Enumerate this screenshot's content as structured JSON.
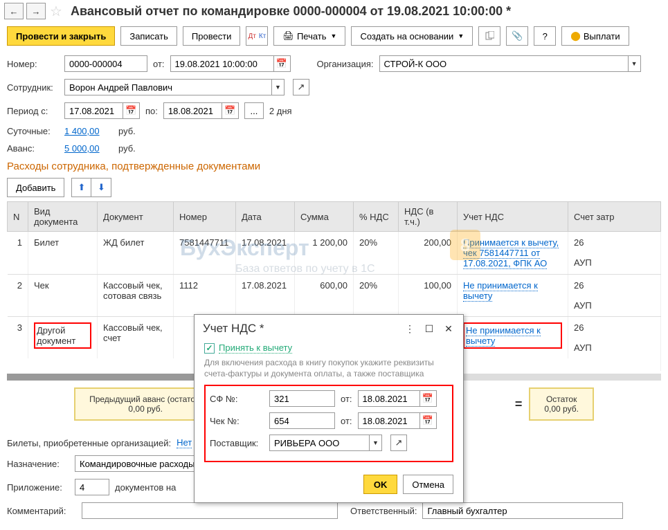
{
  "header": {
    "title": "Авансовый отчет по командировке 0000-000004 от 19.08.2021 10:00:00 *"
  },
  "toolbar": {
    "post_close": "Провести и закрыть",
    "write": "Записать",
    "post": "Провести",
    "print": "Печать",
    "create_based": "Создать на основании",
    "pay": "Выплати"
  },
  "form": {
    "number_label": "Номер:",
    "number": "0000-000004",
    "from_label": "от:",
    "date": "19.08.2021 10:00:00",
    "org_label": "Организация:",
    "org": "СТРОЙ-К ООО",
    "employee_label": "Сотрудник:",
    "employee": "Ворон Андрей Павлович",
    "period_from_label": "Период с:",
    "period_from": "17.08.2021",
    "period_to_label": "по:",
    "period_to": "18.08.2021",
    "days": "2 дня",
    "perdiem_label": "Суточные:",
    "perdiem": "1 400,00",
    "advance_label": "Аванс:",
    "advance": "5 000,00",
    "rub": "руб."
  },
  "section": {
    "title": "Расходы сотрудника, подтвержденные документами",
    "add": "Добавить"
  },
  "table": {
    "headers": {
      "n": "N",
      "doc_type": "Вид документа",
      "doc": "Документ",
      "num": "Номер",
      "date": "Дата",
      "sum": "Сумма",
      "vat_pct": "% НДС",
      "vat_incl": "НДС (в т.ч.)",
      "vat_acc": "Учет НДС",
      "exp_acc": "Счет затр"
    },
    "rows": [
      {
        "n": "1",
        "doc_type": "Билет",
        "doc": "ЖД билет",
        "num": "7581447711",
        "date": "17.08.2021",
        "sum": "1 200,00",
        "vat_pct": "20%",
        "vat_incl": "200,00",
        "vat_acc": "Принимается к вычету, чек 7581447711 от 17.08.2021, ФПК АО",
        "exp1": "26",
        "exp2": "АУП"
      },
      {
        "n": "2",
        "doc_type": "Чек",
        "doc": "Кассовый чек, сотовая связь",
        "num": "1112",
        "date": "17.08.2021",
        "sum": "600,00",
        "vat_pct": "20%",
        "vat_incl": "100,00",
        "vat_acc": "Не принимается к вычету",
        "exp1": "26",
        "exp2": "АУП"
      },
      {
        "n": "3",
        "doc_type": "Другой документ",
        "doc": "Кассовый чек, счет",
        "num": "",
        "date": "",
        "sum": "",
        "vat_pct": "",
        "vat_incl": "",
        "vat_acc": "Не принимается к вычету",
        "exp1": "26",
        "exp2": "АУП"
      }
    ]
  },
  "summary": {
    "prev": "Предыдущий аванс (остаток)",
    "prev_val": "0,00 руб.",
    "rest": "Остаток",
    "rest_val": "0,00 руб."
  },
  "bottom": {
    "tickets_label": "Билеты, приобретенные организацией:",
    "tickets_link": "Нет",
    "purpose_label": "Назначение:",
    "purpose": "Командировочные расходы",
    "attach_label": "Приложение:",
    "attach_val": "4",
    "attach_suffix": "документов на",
    "comment_label": "Комментарий:",
    "responsible_label": "Ответственный:",
    "responsible": "Главный бухгалтер"
  },
  "popup": {
    "title": "Учет НДС *",
    "accept": "Принять к вычету",
    "hint": "Для включения расхода в книгу покупок укажите реквизиты счета-фактуры и документа оплаты, а также поставщика",
    "sf_label": "СФ №:",
    "sf": "321",
    "sf_date_label": "от:",
    "sf_date": "18.08.2021",
    "chk_label": "Чек №:",
    "chk": "654",
    "chk_date_label": "от:",
    "chk_date": "18.08.2021",
    "supplier_label": "Поставщик:",
    "supplier": "РИВЬЕРА ООО",
    "ok": "OK",
    "cancel": "Отмена"
  },
  "watermark": "БухЭксперт",
  "watermark_sub": "База ответов по учету в 1С"
}
